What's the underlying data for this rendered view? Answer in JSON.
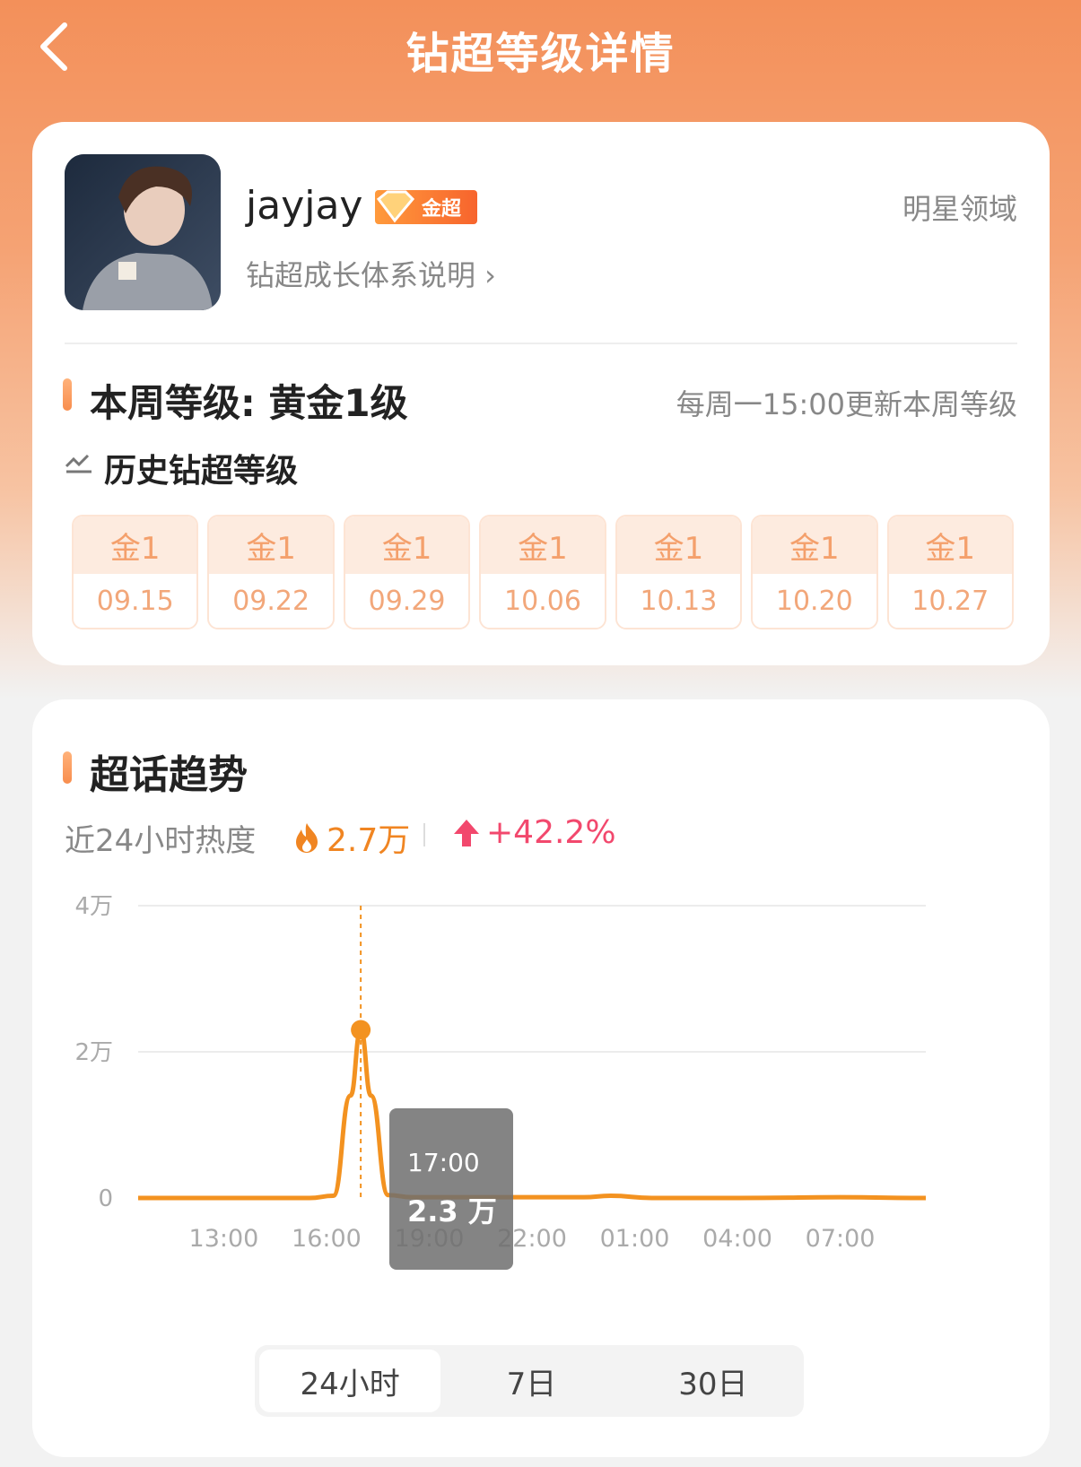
{
  "header": {
    "title": "钻超等级详情"
  },
  "profile": {
    "username": "jayjay",
    "badge_label": "金超",
    "growth_link": "钻超成长体系说明 ›",
    "domain_label": "明星领域"
  },
  "week": {
    "title": "本周等级: 黄金1级",
    "update_note": "每周一15:00更新本周等级"
  },
  "history": {
    "title": "历史钻超等级",
    "items": [
      {
        "grade": "金1",
        "date": "09.15"
      },
      {
        "grade": "金1",
        "date": "09.22"
      },
      {
        "grade": "金1",
        "date": "09.29"
      },
      {
        "grade": "金1",
        "date": "10.06"
      },
      {
        "grade": "金1",
        "date": "10.13"
      },
      {
        "grade": "金1",
        "date": "10.20"
      },
      {
        "grade": "金1",
        "date": "10.27"
      }
    ]
  },
  "trend": {
    "title": "超话趋势",
    "heat_label": "近24小时热度",
    "heat_value": "2.7万",
    "change": "+42.2%",
    "colors": {
      "line": "#f39220",
      "up": "#f2486d"
    }
  },
  "tooltip": {
    "time": "17:00",
    "value": "2.3 万"
  },
  "periods": [
    "24小时",
    "7日",
    "30日"
  ],
  "chart_data": {
    "type": "line",
    "ylim": [
      0,
      40000
    ],
    "y_ticks": [
      "0",
      "2万",
      "4万"
    ],
    "x_ticks": [
      "13:00",
      "16:00",
      "19:00",
      "22:00",
      "01:00",
      "04:00",
      "07:00"
    ],
    "x_range_hours": [
      10.5,
      33.5
    ],
    "grid": true,
    "series": [
      {
        "x": [
          10.5,
          15.5,
          16.2,
          16.7,
          17.0,
          17.3,
          17.8,
          18.5,
          21.0,
          23.5,
          24.3,
          25.5,
          28.0,
          31.0,
          33.5
        ],
        "values": [
          0,
          0,
          300,
          14000,
          23000,
          14000,
          400,
          100,
          100,
          100,
          300,
          0,
          0,
          100,
          0
        ]
      }
    ],
    "highlight": {
      "x": 17.0,
      "value": 23000
    }
  }
}
